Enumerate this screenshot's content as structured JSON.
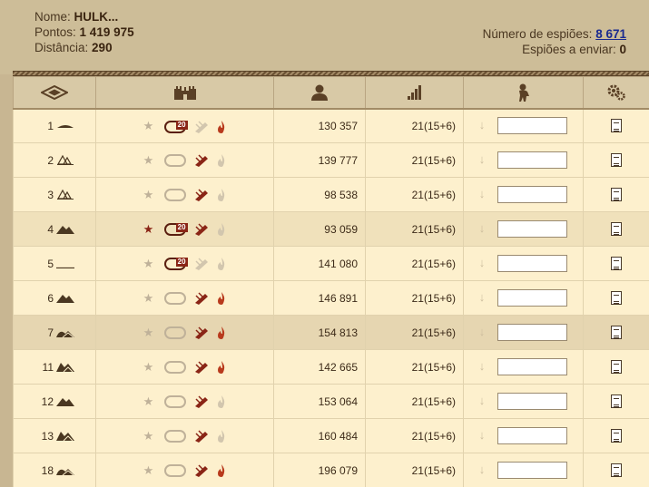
{
  "player": {
    "name_label": "Nome:",
    "name": "HULK...",
    "points_label": "Pontos:",
    "points": "1 419 975",
    "distance_label": "Distância:",
    "distance": "290"
  },
  "spies": {
    "count_label": "Número de espiões:",
    "count": "8 671",
    "send_label": "Espiões a enviar:",
    "send": "0"
  },
  "columns": [
    "eye-icon",
    "castle-icon",
    "person-icon",
    "signal-bars-icon",
    "spy-icon",
    "gears-icon"
  ],
  "colors": {
    "accent": "#8a2516",
    "link": "#1a2a8f"
  },
  "rows": [
    {
      "num": "1",
      "terrain": "hill",
      "starred": false,
      "dove": "active",
      "dove_tag": "20",
      "ram": "faded",
      "flame": "red",
      "points": "130 357",
      "troops": "21(15+6)",
      "spy_value": ""
    },
    {
      "num": "2",
      "terrain": "forest",
      "starred": false,
      "dove": "faded",
      "dove_tag": "",
      "ram": "active",
      "flame": "faded",
      "points": "139 777",
      "troops": "21(15+6)",
      "spy_value": ""
    },
    {
      "num": "3",
      "terrain": "forest",
      "starred": false,
      "dove": "faded",
      "dove_tag": "",
      "ram": "active",
      "flame": "faded",
      "points": "98 538",
      "troops": "21(15+6)",
      "spy_value": ""
    },
    {
      "num": "4",
      "terrain": "mount",
      "starred": true,
      "dove": "active",
      "dove_tag": "20",
      "ram": "active",
      "flame": "faded",
      "points": "93 059",
      "troops": "21(15+6)",
      "spy_value": ""
    },
    {
      "num": "5",
      "terrain": "plain",
      "starred": false,
      "dove": "active",
      "dove_tag": "20",
      "ram": "faded",
      "flame": "faded",
      "points": "141 080",
      "troops": "21(15+6)",
      "spy_value": ""
    },
    {
      "num": "6",
      "terrain": "mount",
      "starred": false,
      "dove": "faded",
      "dove_tag": "",
      "ram": "active",
      "flame": "red",
      "points": "146 891",
      "troops": "21(15+6)",
      "spy_value": ""
    },
    {
      "num": "7",
      "terrain": "mount2",
      "starred": false,
      "dove": "faded",
      "dove_tag": "",
      "ram": "active",
      "flame": "red",
      "points": "154 813",
      "troops": "21(15+6)",
      "spy_value": ""
    },
    {
      "num": "11",
      "terrain": "mount3",
      "starred": false,
      "dove": "faded",
      "dove_tag": "",
      "ram": "active",
      "flame": "red",
      "points": "142 665",
      "troops": "21(15+6)",
      "spy_value": ""
    },
    {
      "num": "12",
      "terrain": "mount",
      "starred": false,
      "dove": "faded",
      "dove_tag": "",
      "ram": "active",
      "flame": "faded",
      "points": "153 064",
      "troops": "21(15+6)",
      "spy_value": ""
    },
    {
      "num": "13",
      "terrain": "mount3",
      "starred": false,
      "dove": "faded",
      "dove_tag": "",
      "ram": "active",
      "flame": "faded",
      "points": "160 484",
      "troops": "21(15+6)",
      "spy_value": ""
    },
    {
      "num": "18",
      "terrain": "mount2",
      "starred": false,
      "dove": "faded",
      "dove_tag": "",
      "ram": "active",
      "flame": "red",
      "points": "196 079",
      "troops": "21(15+6)",
      "spy_value": ""
    }
  ]
}
